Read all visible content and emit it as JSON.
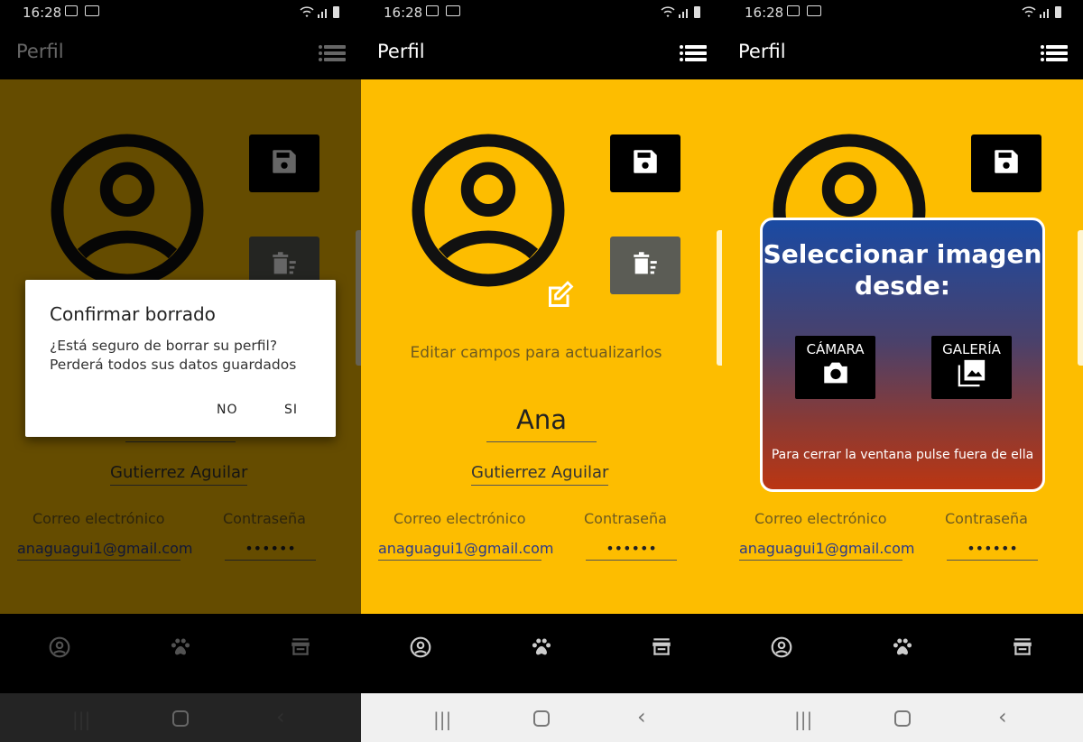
{
  "status": {
    "time": "16:28"
  },
  "appbar": {
    "title": "Perfil"
  },
  "profile": {
    "hint": "Editar campos para actualizarlos",
    "name": "Ana",
    "surname": "Gutierrez Aguilar",
    "email_label": "Correo electrónico",
    "password_label": "Contraseña",
    "email": "anaguagui1@gmail.com",
    "password": "••••••"
  },
  "delete_dialog": {
    "title": "Confirmar borrado",
    "body": "¿Está seguro de borrar su perfil? Perderá todos sus datos guardados",
    "no": "NO",
    "yes": "SI"
  },
  "image_dialog": {
    "title": "Seleccionar imagen desde:",
    "camera": "CÁMARA",
    "gallery": "GALERÍA",
    "footer": "Para cerrar la ventana pulse fuera de ella"
  },
  "colors": {
    "accent": "#fdbd00"
  }
}
